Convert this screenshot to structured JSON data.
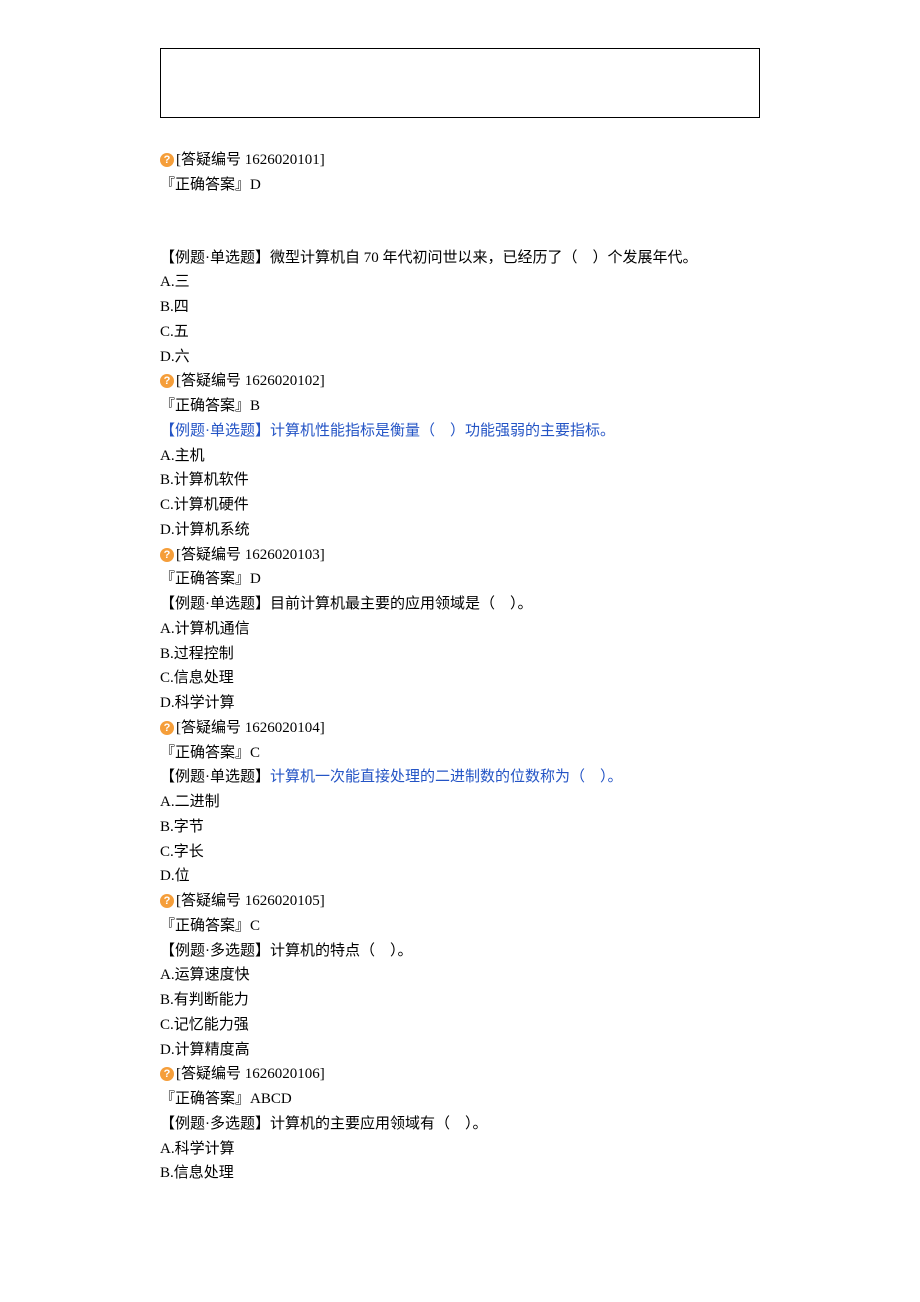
{
  "q1": {
    "ref_label": "[答疑编号 1626020101]",
    "ans": "『正确答案』D"
  },
  "q2": {
    "stem": "【例题·单选题】微型计算机自 70 年代初问世以来，已经历了（　）个发展年代。",
    "a": "A.三",
    "b": "B.四",
    "c": "C.五",
    "d": "D.六",
    "ref_label": "[答疑编号 1626020102]",
    "ans": "『正确答案』B"
  },
  "q3": {
    "stem": "【例题·单选题】计算机性能指标是衡量（　）功能强弱的主要指标。",
    "a": "A.主机",
    "b": "B.计算机软件",
    "c": "C.计算机硬件",
    "d": "D.计算机系统",
    "ref_label": "[答疑编号 1626020103]",
    "ans": "『正确答案』D"
  },
  "q4": {
    "stem": "【例题·单选题】目前计算机最主要的应用领域是（　）。",
    "a": "A.计算机通信",
    "b": "B.过程控制",
    "c": "C.信息处理",
    "d": "D.科学计算",
    "ref_label": "[答疑编号 1626020104]",
    "ans": "『正确答案』C"
  },
  "q5": {
    "stem_prefix": "【例题·单选题】",
    "stem_blue": "计算机一次能直接处理的二进制数的位数称为（　）。",
    "a": "A.二进制",
    "b": "B.字节",
    "c": "C.字长",
    "d": "D.位",
    "ref_label": "[答疑编号 1626020105]",
    "ans": "『正确答案』C"
  },
  "q6": {
    "stem": "【例题·多选题】计算机的特点（　）。",
    "a": "A.运算速度快",
    "b": "B.有判断能力",
    "c": "C.记忆能力强",
    "d": "D.计算精度高",
    "ref_label": "[答疑编号 1626020106]",
    "ans": "『正确答案』ABCD"
  },
  "q7": {
    "stem": "【例题·多选题】计算机的主要应用领域有（　）。",
    "a": "A.科学计算",
    "b": "B.信息处理"
  }
}
